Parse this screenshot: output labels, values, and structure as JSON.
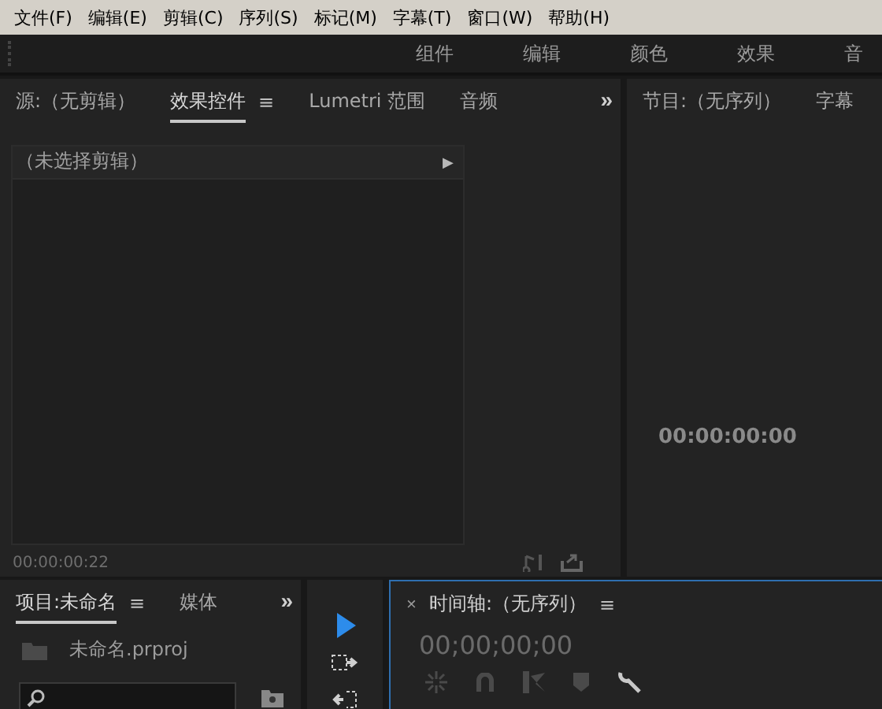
{
  "menu": [
    {
      "label": "文件(F)"
    },
    {
      "label": "编辑(E)"
    },
    {
      "label": "剪辑(C)"
    },
    {
      "label": "序列(S)"
    },
    {
      "label": "标记(M)"
    },
    {
      "label": "字幕(T)"
    },
    {
      "label": "窗口(W)"
    },
    {
      "label": "帮助(H)"
    }
  ],
  "workspaces": [
    "组件",
    "编辑",
    "颜色",
    "效果",
    "音"
  ],
  "source_panel": {
    "tabs": [
      {
        "label": "源:（无剪辑）",
        "selected": false
      },
      {
        "label": "效果控件",
        "selected": true,
        "menu": "≡"
      },
      {
        "label": "Lumetri 范围",
        "selected": false
      },
      {
        "label": "音频",
        "selected": false
      }
    ],
    "overflow": "»",
    "clip_header": "（未选择剪辑）",
    "expand": "▶",
    "timecode": "00:00:00:22"
  },
  "program_panel": {
    "tabs": [
      {
        "label": "节目:（无序列）",
        "selected": false
      },
      {
        "label": "字幕",
        "selected": false
      }
    ],
    "timecode": "00:00:00:00"
  },
  "project_panel": {
    "tabs": [
      {
        "label": "项目:未命名",
        "selected": true,
        "menu": "≡"
      },
      {
        "label": "媒体",
        "selected": false
      }
    ],
    "overflow": "»",
    "file": "未命名.prproj"
  },
  "tools": [
    {
      "kind": "selection",
      "selected": true
    },
    {
      "kind": "track-select",
      "selected": false
    },
    {
      "kind": "ripple",
      "selected": false
    }
  ],
  "timeline_panel": {
    "close": "×",
    "title": "时间轴:（无序列）",
    "menu": "≡",
    "timecode": "00;00;00;00"
  }
}
